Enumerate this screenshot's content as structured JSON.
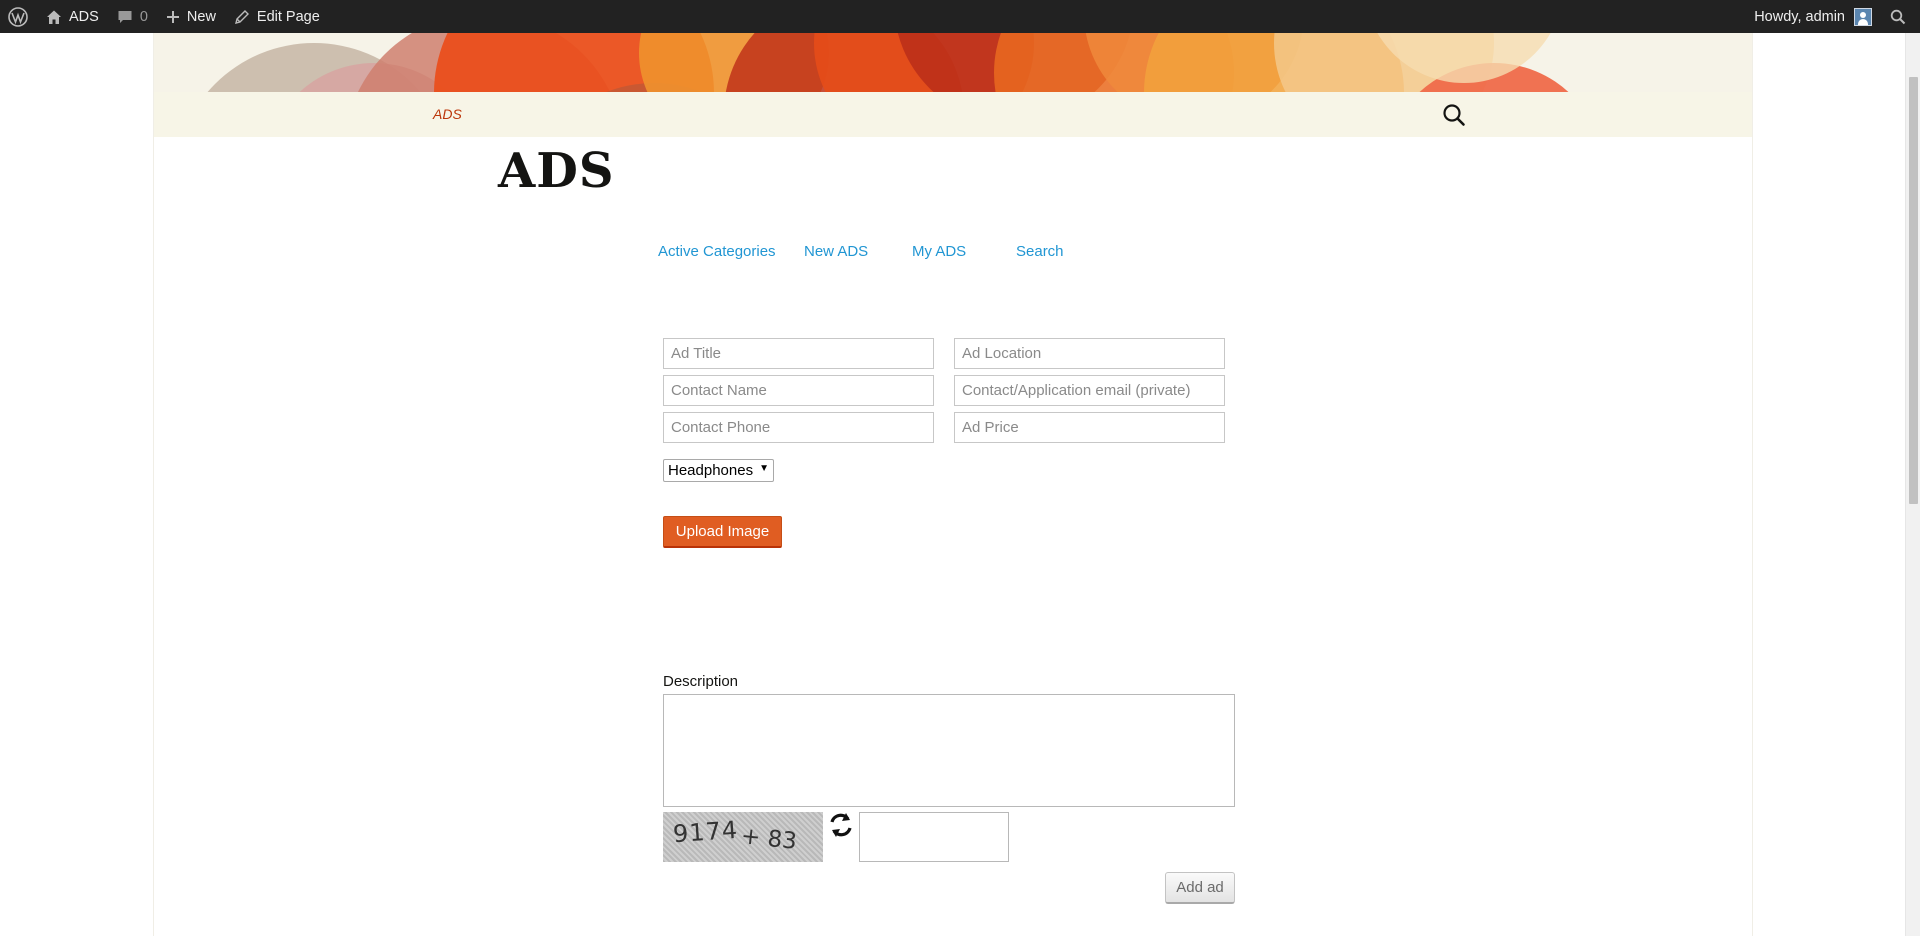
{
  "adminbar": {
    "site_name": "ADS",
    "comments_count": "0",
    "new_label": "New",
    "edit_label": "Edit Page",
    "greeting": "Howdy, admin"
  },
  "site": {
    "nav_item": "ADS",
    "page_title": "ADS"
  },
  "subnav": {
    "items": [
      "Active Categories",
      "New ADS",
      "My ADS",
      "Search"
    ]
  },
  "form": {
    "ad_title_placeholder": "Ad Title",
    "ad_location_placeholder": "Ad Location",
    "contact_name_placeholder": "Contact Name",
    "contact_email_placeholder": "Contact/Application email (private)",
    "contact_phone_placeholder": "Contact Phone",
    "ad_price_placeholder": "Ad Price",
    "category_selected": "Headphones",
    "upload_label": "Upload Image",
    "description_label": "Description",
    "captcha_text_1": "9174",
    "captcha_text_2": "+ 83",
    "submit_label": "Add ad"
  },
  "colors": {
    "accent": "#e05d22",
    "link": "#2196d3",
    "nav_active": "#bc360a",
    "adminbar_bg": "#222222"
  }
}
